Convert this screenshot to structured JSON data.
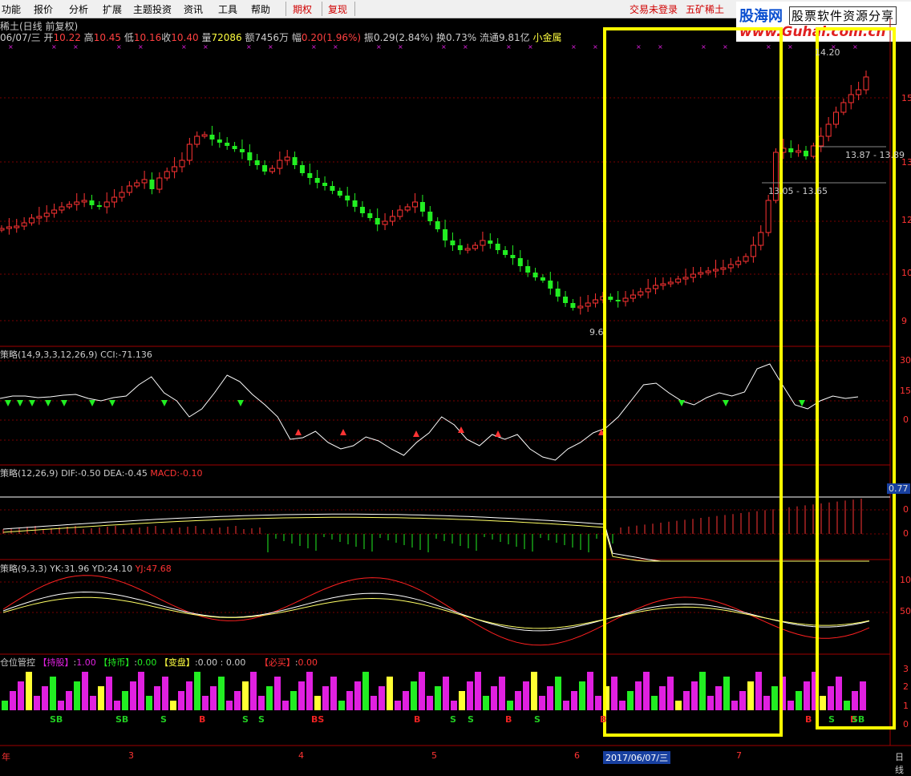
{
  "menu": {
    "items": [
      "功能",
      "报价",
      "分析",
      "扩展",
      "主题投资",
      "资讯",
      "工具",
      "帮助"
    ],
    "options_label": "期权",
    "review_label": "复现",
    "login_status": "交易未登录",
    "stock_short": "五矿稀土"
  },
  "watermark": {
    "brand": "股海网",
    "tagline": "股票软件资源分享",
    "url": "www.Guhai.com.cn"
  },
  "chart_header": {
    "title": "稀土(日线 前复权)",
    "date": "06/07/三",
    "open_label": "开",
    "open": "10.22",
    "high_label": "高",
    "high": "10.45",
    "low_label": "低",
    "low": "10.16",
    "close_label": "收",
    "close": "10.40",
    "volume_label": "量",
    "volume": "72086",
    "amount_label": "额",
    "amount": "7456万",
    "change_label": "幅",
    "change": "0.20(1.96%)",
    "amplitude_label": "振",
    "amplitude": "0.29(2.84%)",
    "turnover_label": "换",
    "turnover": "0.73%",
    "float_label": "流通",
    "float_cap": "9.81亿",
    "sector": "小金属"
  },
  "price_annotations": {
    "low_marker": "9.6",
    "high_marker": "14.20",
    "range1": "13.87 - 13.89",
    "range2": "13.05 - 13.65"
  },
  "price_axis": [
    "15",
    "13",
    "12",
    "10",
    "9"
  ],
  "cci_panel": {
    "title": "策略(14,9,3,3,12,26,9)",
    "value_label": "CCI:",
    "value": "-71.136",
    "axis": [
      "30",
      "15",
      "0"
    ]
  },
  "macd_panel": {
    "title": "策略(12,26,9)",
    "dif_label": "DIF:",
    "dif": "-0.50",
    "dea_label": "DEA:",
    "dea": "-0.45",
    "macd_label": "MACD:",
    "macd": "-0.10",
    "axis": [
      "0.77",
      "0",
      "0"
    ]
  },
  "kdj_panel": {
    "title": "策略(9,3,3)",
    "yk_label": "YK:",
    "yk": "31.96",
    "yd_label": "YD:",
    "yd": "24.10",
    "yj_label": "YJ:",
    "yj": "47.68",
    "axis": [
      "10",
      "50"
    ]
  },
  "position_panel": {
    "title": "仓位管控",
    "hold_label": "【持股】",
    "hold": "1.00",
    "cash_label": "【持币】",
    "cash": "0.00",
    "change_label": "【变盘】",
    "change": "0.00 : 0.00",
    "buy_label": "【必买】",
    "buy": "0.00",
    "axis": [
      "3",
      "2",
      "1",
      "0"
    ]
  },
  "signals": [
    {
      "text": "SB",
      "color": "#22cc22"
    },
    {
      "text": "SB",
      "color": "#22cc22"
    },
    {
      "text": "S",
      "color": "#22cc22"
    },
    {
      "text": "B",
      "color": "#ee2222"
    },
    {
      "text": "S",
      "color": "#22cc22"
    },
    {
      "text": "S",
      "color": "#22cc22"
    },
    {
      "text": "BS",
      "color": "#ee2222"
    },
    {
      "text": "B",
      "color": "#ee2222"
    },
    {
      "text": "S",
      "color": "#22cc22"
    },
    {
      "text": "S",
      "color": "#22cc22"
    },
    {
      "text": "B",
      "color": "#ee2222"
    },
    {
      "text": "S",
      "color": "#22cc22"
    },
    {
      "text": "B",
      "color": "#ee2222"
    },
    {
      "text": "B",
      "color": "#ee2222"
    },
    {
      "text": "S",
      "color": "#22cc22"
    },
    {
      "text": "B",
      "color": "#ee2222"
    },
    {
      "text": "SB",
      "color": "#22cc22"
    }
  ],
  "time_axis": {
    "months": [
      "年",
      "3",
      "4",
      "5",
      "6",
      "7"
    ],
    "cursor_date": "2017/06/07/三",
    "period": "日线"
  },
  "colors": {
    "up": "#ff3333",
    "down": "#22ee22",
    "highlight": "#ffff00",
    "magenta": "#e020e0",
    "grid": "#7a0000",
    "cci": "#ffffff"
  }
}
